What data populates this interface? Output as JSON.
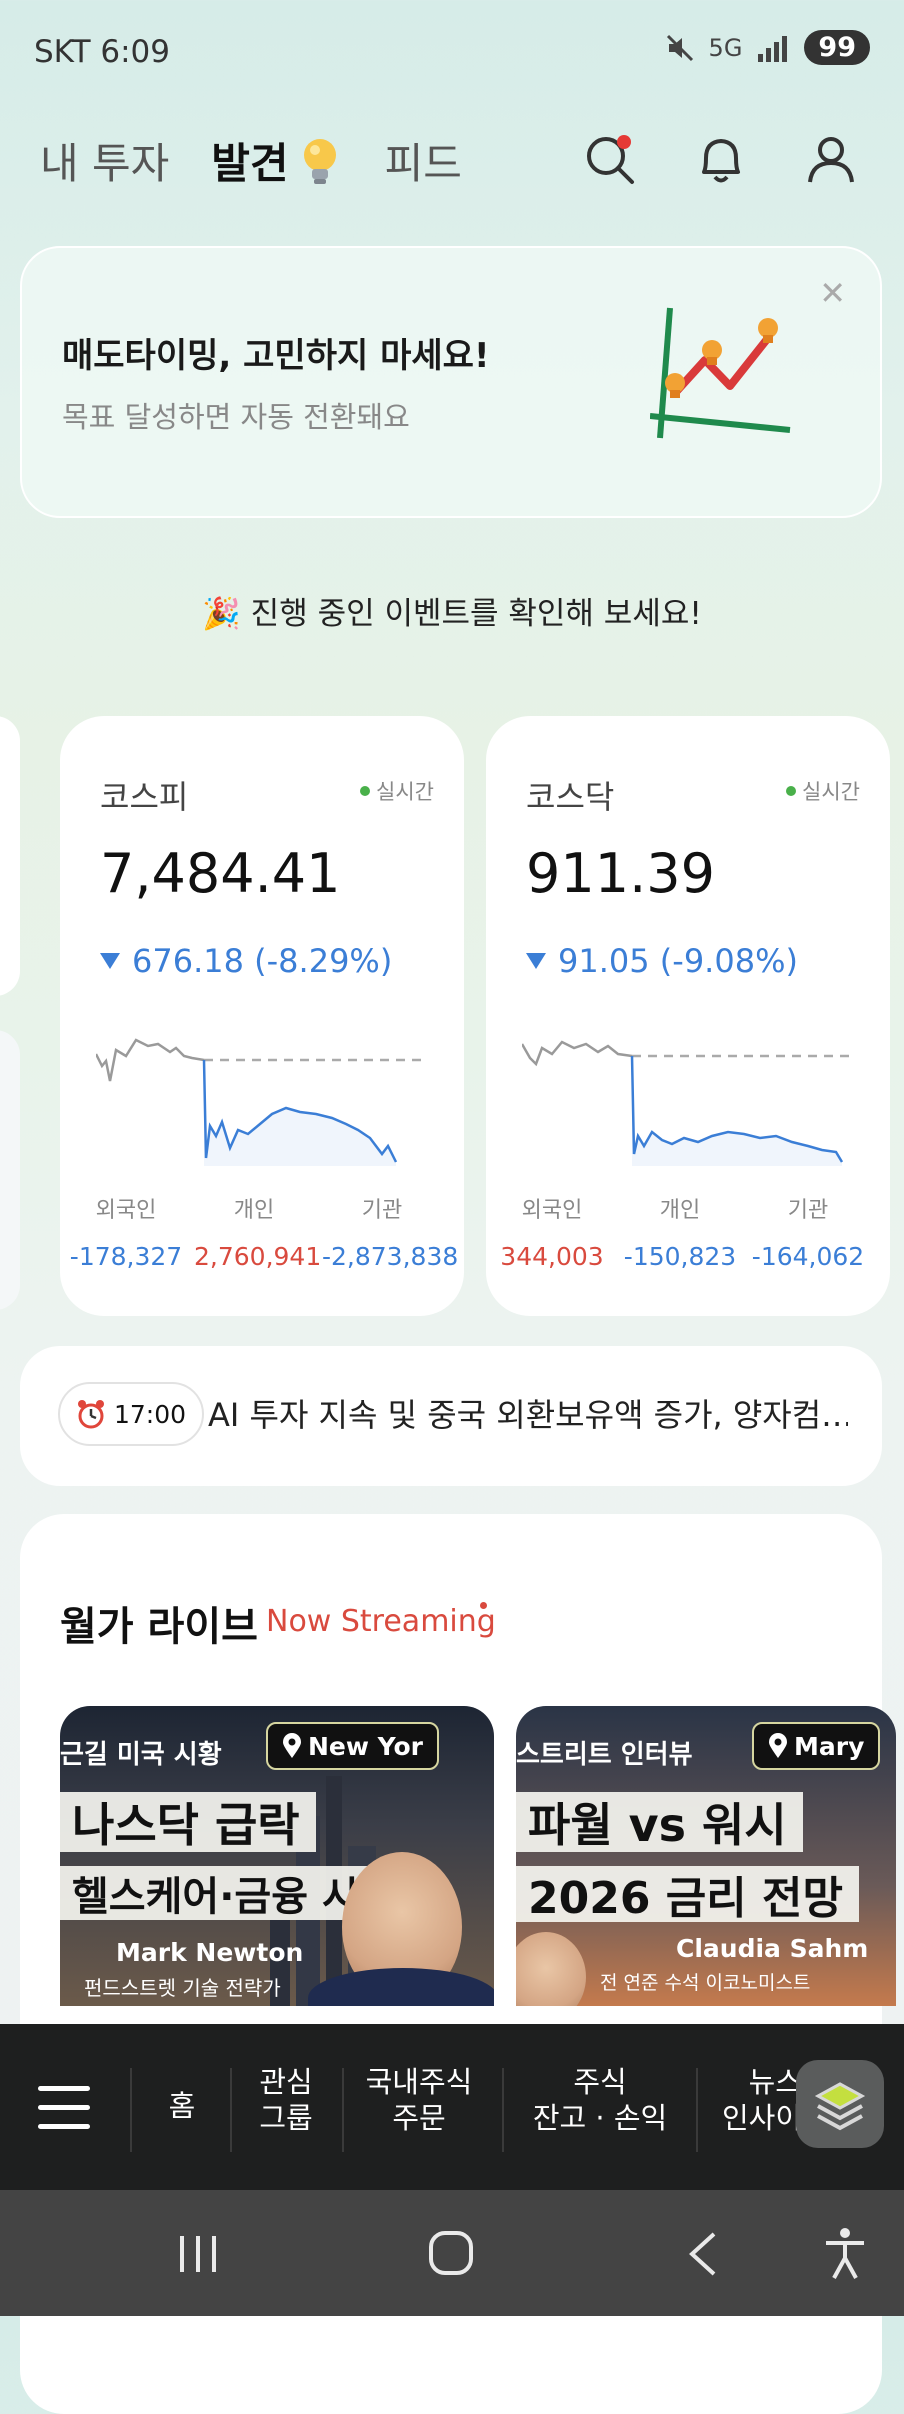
{
  "status_bar": {
    "carrier_time": "SKT 6:09",
    "battery": "99",
    "network": "5G"
  },
  "header": {
    "tabs": [
      "내 투자",
      "발견",
      "피드"
    ],
    "active_tab": "발견",
    "icons": [
      "search-icon",
      "bell-icon",
      "user-icon"
    ]
  },
  "promo": {
    "title": "매도타이밍, 고민하지 마세요!",
    "subtitle": "목표 달성하면 자동 전환돼요",
    "close": "✕"
  },
  "event_text": "진행 중인 이벤트를 확인해 보세요!",
  "indices": [
    {
      "name": "코스피",
      "realtime": "실시간",
      "value": "7,484.41",
      "change": "676.18 (-8.29%)",
      "investors": [
        {
          "label": "외국인",
          "value": "-178,327"
        },
        {
          "label": "개인",
          "value": "2,760,941"
        },
        {
          "label": "기관",
          "value": "-2,873,838"
        }
      ]
    },
    {
      "name": "코스닥",
      "realtime": "실시간",
      "value": "911.39",
      "change": "91.05 (-9.08%)",
      "investors": [
        {
          "label": "외국인",
          "value": "344,003"
        },
        {
          "label": "개인",
          "value": "-150,823"
        },
        {
          "label": "기관",
          "value": "-164,062"
        }
      ]
    }
  ],
  "news": {
    "time": "17:00",
    "headline": "AI 투자 지속 및 중국 외환보유액 증가, 양자컴…"
  },
  "wall_street_live": {
    "title": "월가 라이브",
    "streaming": "Now Streaming",
    "videos": [
      {
        "header": "근길 미국 시황",
        "location": "New Yor",
        "banner1": "나스닥 급락",
        "banner2": "헬스케어·금융 시작?",
        "person": "Mark Newton",
        "role": "펀드스트렛 기술 전략가"
      },
      {
        "header": "스트리트 인터뷰",
        "location": "Mary",
        "banner1": "파월 vs 워시",
        "banner2": "2026 금리 전망",
        "person": "Claudia Sahm",
        "role": "전 연준 수석 이코노미스트"
      }
    ]
  },
  "bottom_nav": {
    "items": [
      "홈",
      "관심\n그룹",
      "국내주식\n주문",
      "주식\n잔고 · 손익",
      "뉴스\n인사이"
    ]
  },
  "colors": {
    "down": "#3b7ed6",
    "up": "#d94a3e",
    "accent_green": "#49b04a"
  }
}
